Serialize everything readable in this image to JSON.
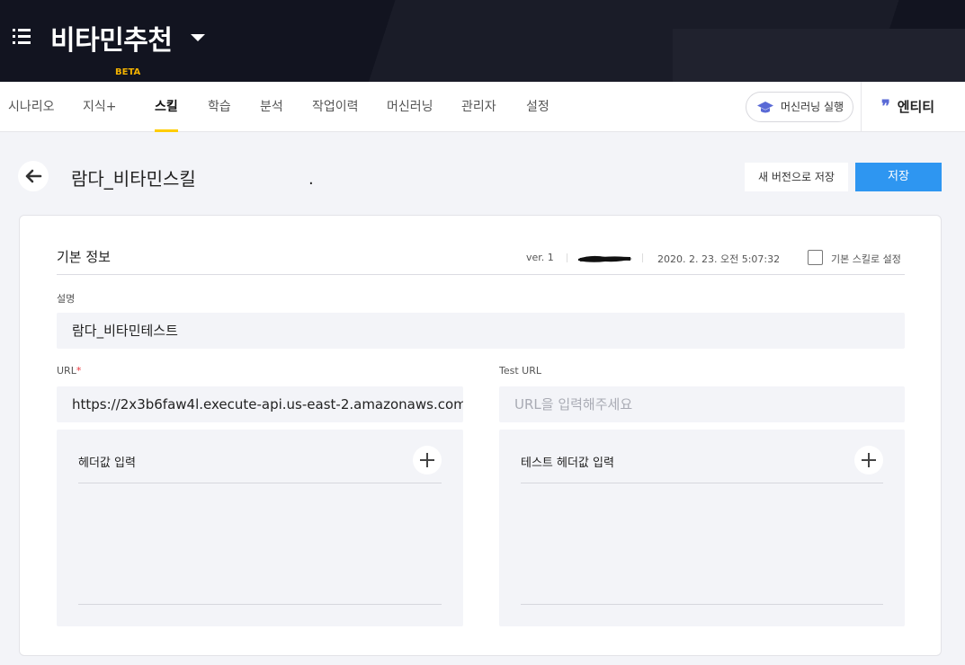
{
  "header": {
    "app_title": "비타민추천"
  },
  "nav": {
    "tabs": [
      {
        "label": "시나리오"
      },
      {
        "label": "지식+",
        "badge": "BETA"
      },
      {
        "label": "스킬"
      },
      {
        "label": "학습"
      },
      {
        "label": "분석"
      },
      {
        "label": "작업이력"
      },
      {
        "label": "머신러닝"
      },
      {
        "label": "관리자"
      },
      {
        "label": "설정"
      }
    ],
    "active_tab": "스킬",
    "ml_run_label": "머신러닝 실행",
    "entity_label": "엔티티"
  },
  "skill": {
    "name": "람다_비타민스킬",
    "trailing_mark": ".",
    "save_new_version_label": "새 버전으로 저장",
    "save_label": "저장"
  },
  "basic_info": {
    "title": "기본 정보",
    "version": "ver. 1",
    "timestamp": "2020. 2. 23. 오전 5:07:32",
    "default_skill_label": "기본 스킬로 설정",
    "default_skill_checked": false
  },
  "form": {
    "description_label": "설명",
    "description_value": "람다_비타민테스트",
    "url_label": "URL",
    "url_required_mark": "*",
    "url_value": "https://2x3b6faw4l.execute-api.us-east-2.amazonaws.com",
    "test_url_label": "Test URL",
    "test_url_placeholder": "URL을 입력해주세요",
    "header_input_label": "헤더값 입력",
    "test_header_input_label": "테스트 헤더값 입력"
  },
  "colors": {
    "header_bg": "#121420",
    "accent_yellow": "#ffcd00",
    "primary_blue": "#2e96f1",
    "required_red": "#e8353b",
    "entity_icon": "#5a6ad6"
  },
  "icons": [
    "menu-icon",
    "caret-down-icon",
    "graduation-cap-icon",
    "quote-icon",
    "arrow-left-icon",
    "plus-icon",
    "checkbox-icon"
  ]
}
